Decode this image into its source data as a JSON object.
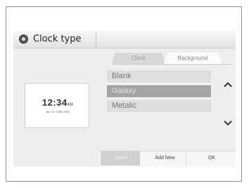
{
  "title": {
    "label": "Clock type",
    "icon": "gear-icon"
  },
  "tabs": [
    {
      "label": "Clock",
      "active": false
    },
    {
      "label": "Background",
      "active": true
    }
  ],
  "preview": {
    "time": "12:34",
    "time_suffix": "AM",
    "date": "Jan 15, 2030 (Tue)"
  },
  "list": {
    "items": [
      {
        "label": "Blank",
        "selected": false
      },
      {
        "label": "Galaxy",
        "selected": true
      },
      {
        "label": "Metalic",
        "selected": false
      }
    ],
    "scroll_up": "^",
    "scroll_down": "⌄"
  },
  "buttons": {
    "select": "Select",
    "add_new": "Add New",
    "ok": "OK"
  },
  "colors": {
    "selected_item": "#a4a4a4",
    "item": "#dedede",
    "screen": "#eeeeee"
  }
}
